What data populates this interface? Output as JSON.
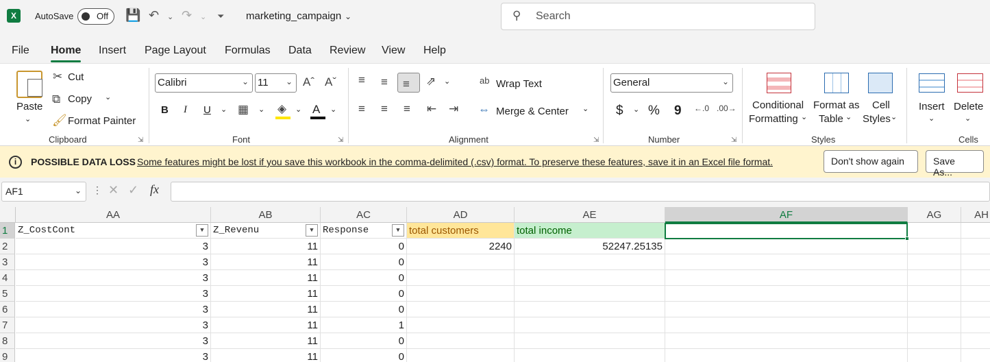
{
  "titlebar": {
    "app_icon": "X",
    "autosave_label": "AutoSave",
    "autosave_state": "Off",
    "filename": "marketing_campaign",
    "search_placeholder": "Search"
  },
  "menu": {
    "tabs": [
      "File",
      "Home",
      "Insert",
      "Page Layout",
      "Formulas",
      "Data",
      "Review",
      "View",
      "Help"
    ],
    "active": "Home"
  },
  "ribbon": {
    "clipboard": {
      "paste": "Paste",
      "cut": "Cut",
      "copy": "Copy",
      "format_painter": "Format Painter",
      "label": "Clipboard"
    },
    "font": {
      "family": "Calibri",
      "size": "11",
      "bold": "B",
      "italic": "I",
      "underline": "U",
      "label": "Font"
    },
    "alignment": {
      "wrap_text": "Wrap Text",
      "merge_center": "Merge & Center",
      "label": "Alignment"
    },
    "number": {
      "format": "General",
      "currency": "$",
      "percent": "%",
      "comma": "9",
      "label": "Number"
    },
    "styles": {
      "conditional_line1": "Conditional",
      "conditional_line2": "Formatting",
      "format_table_line1": "Format as",
      "format_table_line2": "Table",
      "cell_styles_line1": "Cell",
      "cell_styles_line2": "Styles",
      "label": "Styles"
    },
    "cells": {
      "insert": "Insert",
      "delete": "Delete",
      "label": "Cells"
    }
  },
  "infobar": {
    "title": "POSSIBLE DATA LOSS",
    "message": "Some features might be lost if you save this workbook in the comma-delimited (.csv) format. To preserve these features, save it in an Excel file format.",
    "dont_show": "Don't show again",
    "save_as": "Save As..."
  },
  "formula": {
    "name_box": "AF1",
    "content": ""
  },
  "grid": {
    "columns": [
      "AA",
      "AB",
      "AC",
      "AD",
      "AE",
      "AF",
      "AG",
      "AH"
    ],
    "selected_column": "AF",
    "header_row": [
      "Z_CostCont",
      "Z_Revenu",
      "Response",
      "total customers",
      "total income"
    ],
    "row_numbers": [
      "1",
      "2",
      "3",
      "4",
      "5",
      "6",
      "7",
      "8",
      "9"
    ],
    "rows": [
      [
        "3",
        "11",
        "0",
        "2240",
        "52247.25135"
      ],
      [
        "3",
        "11",
        "0",
        "",
        ""
      ],
      [
        "3",
        "11",
        "0",
        "",
        ""
      ],
      [
        "3",
        "11",
        "0",
        "",
        ""
      ],
      [
        "3",
        "11",
        "0",
        "",
        ""
      ],
      [
        "3",
        "11",
        "1",
        "",
        ""
      ],
      [
        "3",
        "11",
        "0",
        "",
        ""
      ],
      [
        "3",
        "11",
        "0",
        "",
        ""
      ]
    ],
    "colors": {
      "total_customers_fill": "#ffe699",
      "total_income_fill": "#c6efce",
      "accent": "#107c41"
    }
  }
}
